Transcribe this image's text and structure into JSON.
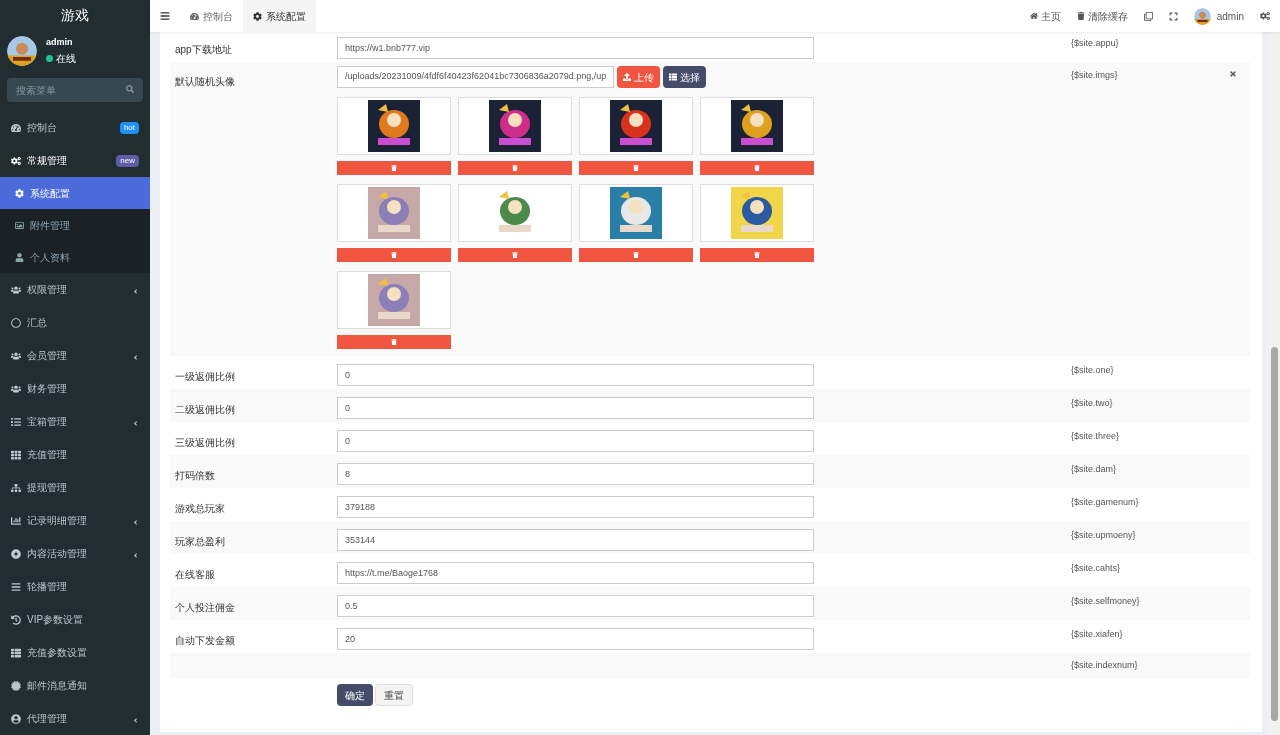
{
  "sidebar": {
    "title": "游戏",
    "user": {
      "name": "admin",
      "status": "在线"
    },
    "search": {
      "placeholder": "搜索菜单"
    },
    "items": [
      {
        "label": "控制台",
        "badge": "hot",
        "color": "#1e90ff",
        "selected": false
      },
      {
        "label": "常规管理",
        "badge": "new",
        "color": "#605ca8",
        "selected": false,
        "expanded": true,
        "children": [
          {
            "label": "系统配置",
            "selected": true
          },
          {
            "label": "附件管理",
            "selected": false
          },
          {
            "label": "个人资料",
            "selected": false
          }
        ]
      },
      {
        "label": "权限管理",
        "selected": false,
        "expanded": false
      },
      {
        "label": "汇总",
        "selected": false
      },
      {
        "label": "会员管理",
        "selected": false,
        "expanded": false
      },
      {
        "label": "财务管理",
        "selected": false
      },
      {
        "label": "宝箱管理",
        "selected": false,
        "expanded": false
      },
      {
        "label": "充值管理",
        "selected": false
      },
      {
        "label": "提现管理",
        "selected": false
      },
      {
        "label": "记录明细管理",
        "selected": false,
        "expanded": false
      },
      {
        "label": "内容活动管理",
        "selected": false,
        "expanded": false
      },
      {
        "label": "轮播管理",
        "selected": false
      },
      {
        "label": "VIP参数设置",
        "selected": false
      },
      {
        "label": "充值参数设置",
        "selected": false
      },
      {
        "label": "邮件消息通知",
        "selected": false
      },
      {
        "label": "代理管理",
        "selected": false,
        "expanded": false
      }
    ]
  },
  "header": {
    "tabs": [
      {
        "label": "控制台",
        "selected": false
      },
      {
        "label": "系统配置",
        "selected": true
      }
    ],
    "links": [
      "主页",
      "清除缓存"
    ],
    "user": "admin"
  },
  "form": {
    "rows": [
      {
        "kind": "text",
        "label": "app下载地址",
        "value": "https://w1.bnb777.vip",
        "variable": "{$site.appu}"
      },
      {
        "kind": "images",
        "label": "默认随机头像",
        "value": "/uploads/20231009/4fdf6f40423f62041bc7306836a2079d.png,/up",
        "upload": "上传",
        "choose": "选择",
        "variable": "{$site.imgs}"
      },
      {
        "kind": "text",
        "label": "一级返佣比例",
        "value": "0",
        "variable": "{$site.one}"
      },
      {
        "kind": "text",
        "label": "二级返佣比例",
        "value": "0",
        "variable": "{$site.two}"
      },
      {
        "kind": "text",
        "label": "三级返佣比例",
        "value": "0",
        "variable": "{$site.three}"
      },
      {
        "kind": "text",
        "label": "打码倍数",
        "value": "8",
        "variable": "{$site.dam}"
      },
      {
        "kind": "text",
        "label": "游戏总玩家",
        "value": "379188",
        "variable": "{$site.gamenum}"
      },
      {
        "kind": "text",
        "label": "玩家总盈利",
        "value": "353144",
        "variable": "{$site.upmoeny}"
      },
      {
        "kind": "text",
        "label": "在线客服",
        "value": "https://t.me/Baoge1768",
        "variable": "{$site.cahts}"
      },
      {
        "kind": "text",
        "label": "个人投注佣金",
        "value": "0.5",
        "variable": "{$site.selfmoney}"
      },
      {
        "kind": "text",
        "label": "自动下发金额",
        "value": "20",
        "variable": "{$site.xiafen}"
      },
      {
        "kind": "empty",
        "variable": "{$site.indexnum}"
      }
    ],
    "buttons": [
      "确定",
      "重置"
    ]
  }
}
